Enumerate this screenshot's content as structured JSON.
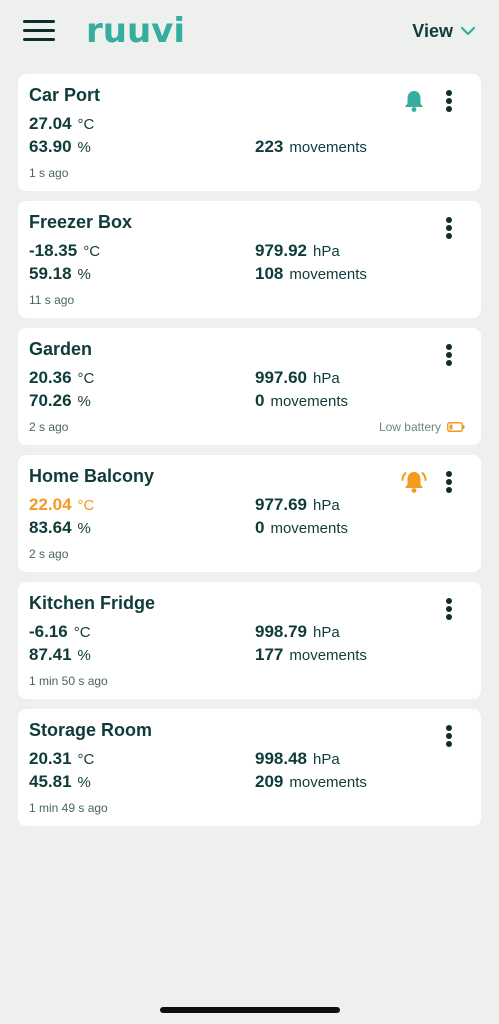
{
  "app": {
    "logo_text": "ruuvi",
    "view_label": "View"
  },
  "colors": {
    "brand": "#35ad9f",
    "alert": "#f39a1f",
    "text": "#0f3b3a",
    "background": "#eef0ee"
  },
  "sensors": [
    {
      "name": "Car Port",
      "temperature": "27.04",
      "temperature_unit": "°C",
      "humidity": "63.90",
      "humidity_unit": "%",
      "pressure": "",
      "pressure_unit": "",
      "movements": "223",
      "movements_unit": "movements",
      "updated": "1 s ago",
      "alert_icon": "bell-icon",
      "alert_state": "normal",
      "low_battery": ""
    },
    {
      "name": "Freezer Box",
      "temperature": "-18.35",
      "temperature_unit": "°C",
      "humidity": "59.18",
      "humidity_unit": "%",
      "pressure": "979.92",
      "pressure_unit": "hPa",
      "movements": "108",
      "movements_unit": "movements",
      "updated": "11 s ago",
      "alert_icon": "",
      "alert_state": "",
      "low_battery": ""
    },
    {
      "name": "Garden",
      "temperature": "20.36",
      "temperature_unit": "°C",
      "humidity": "70.26",
      "humidity_unit": "%",
      "pressure": "997.60",
      "pressure_unit": "hPa",
      "movements": "0",
      "movements_unit": "movements",
      "updated": "2 s ago",
      "alert_icon": "",
      "alert_state": "",
      "low_battery": "Low battery"
    },
    {
      "name": "Home Balcony",
      "temperature": "22.04",
      "temperature_unit": "°C",
      "humidity": "83.64",
      "humidity_unit": "%",
      "pressure": "977.69",
      "pressure_unit": "hPa",
      "movements": "0",
      "movements_unit": "movements",
      "updated": "2 s ago",
      "alert_icon": "bell-ringing-icon",
      "alert_state": "triggered",
      "low_battery": ""
    },
    {
      "name": "Kitchen Fridge",
      "temperature": "-6.16",
      "temperature_unit": "°C",
      "humidity": "87.41",
      "humidity_unit": "%",
      "pressure": "998.79",
      "pressure_unit": "hPa",
      "movements": "177",
      "movements_unit": "movements",
      "updated": "1 min 50 s ago",
      "alert_icon": "",
      "alert_state": "",
      "low_battery": ""
    },
    {
      "name": "Storage Room",
      "temperature": "20.31",
      "temperature_unit": "°C",
      "humidity": "45.81",
      "humidity_unit": "%",
      "pressure": "998.48",
      "pressure_unit": "hPa",
      "movements": "209",
      "movements_unit": "movements",
      "updated": "1 min 49 s ago",
      "alert_icon": "",
      "alert_state": "",
      "low_battery": ""
    }
  ]
}
